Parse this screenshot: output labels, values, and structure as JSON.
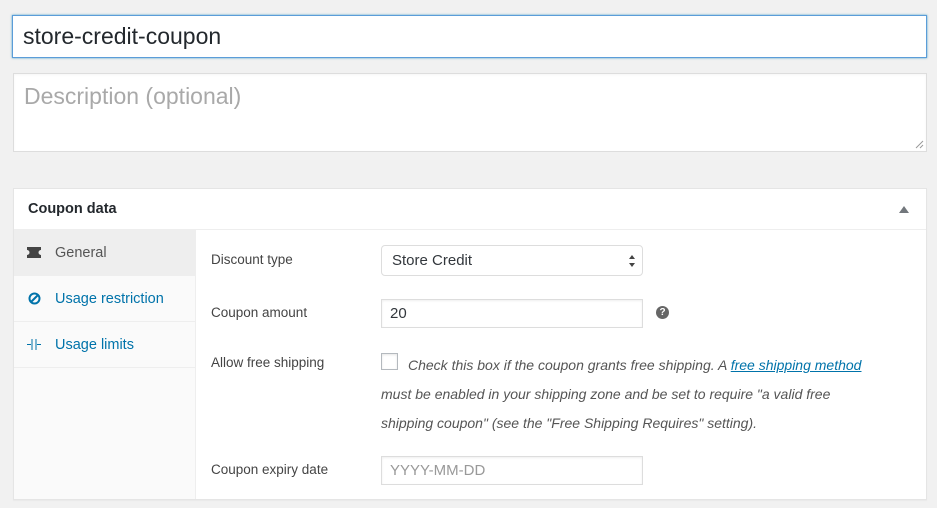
{
  "title_input": {
    "value": "store-credit-coupon"
  },
  "description": {
    "placeholder": "Description (optional)"
  },
  "panel": {
    "title": "Coupon data",
    "tabs": [
      {
        "label": "General",
        "icon": "ticket-icon",
        "active": true
      },
      {
        "label": "Usage restriction",
        "icon": "restriction-icon",
        "active": false
      },
      {
        "label": "Usage limits",
        "icon": "limits-icon",
        "active": false
      }
    ],
    "fields": {
      "discount_type": {
        "label": "Discount type",
        "value": "Store Credit"
      },
      "coupon_amount": {
        "label": "Coupon amount",
        "value": "20",
        "help": "?"
      },
      "free_shipping": {
        "label": "Allow free shipping",
        "text_before": "Check this box if the coupon grants free shipping. A ",
        "link": "free shipping method",
        "text_after": " must be enabled in your shipping zone and be set to require \"a valid free shipping coupon\" (see the \"Free Shipping Requires\" setting).",
        "checked": false
      },
      "expiry_date": {
        "label": "Coupon expiry date",
        "placeholder": "YYYY-MM-DD"
      }
    }
  },
  "colors": {
    "link": "#0073aa",
    "focus_border": "#5b9dd9"
  }
}
